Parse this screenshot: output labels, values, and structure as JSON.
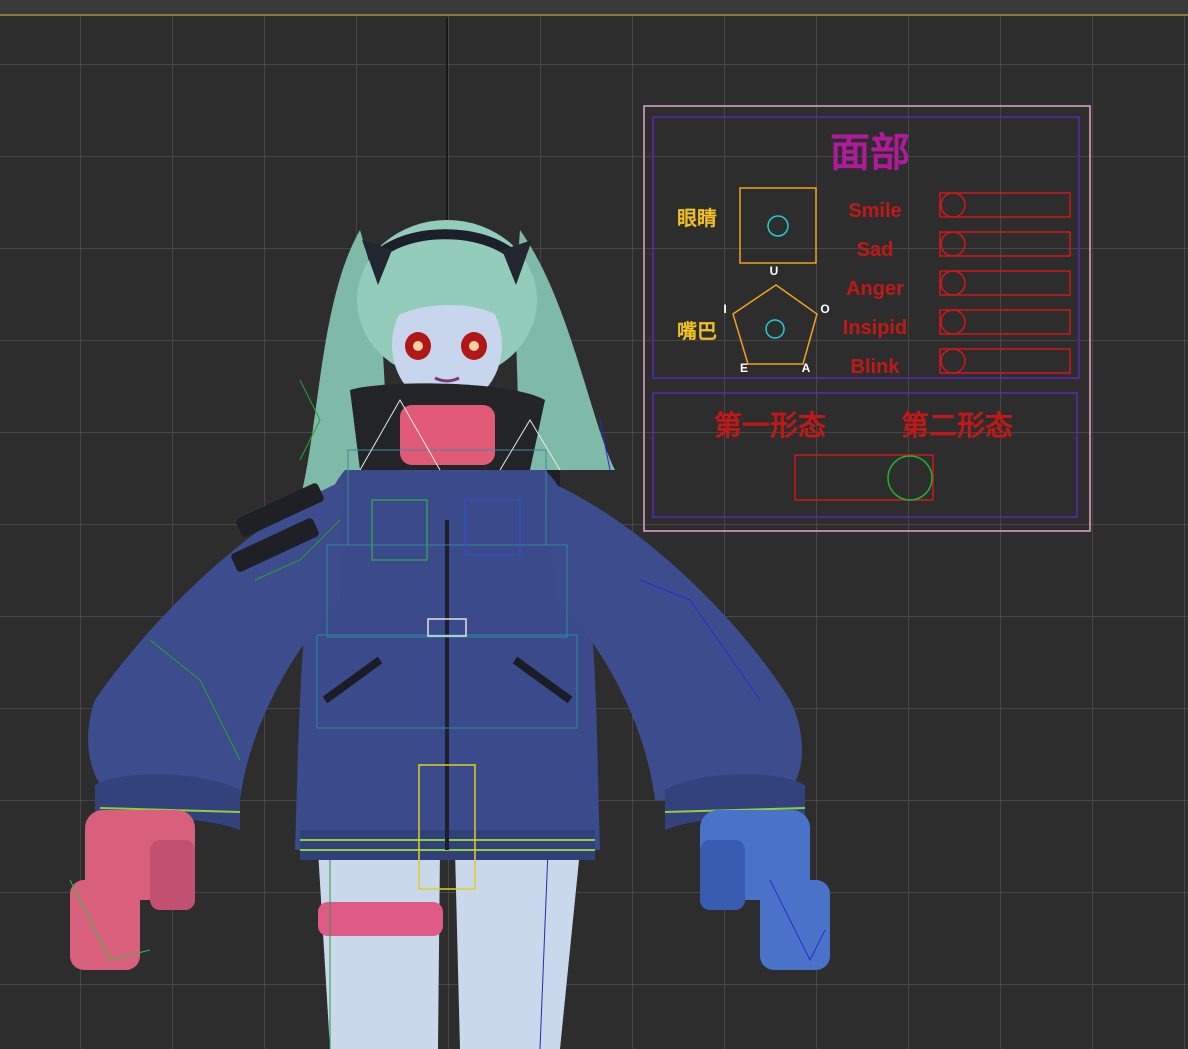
{
  "panel": {
    "title": "面部",
    "eyes_label": "眼睛",
    "mouth_label": "嘴巴",
    "vowels": {
      "u": "U",
      "i": "I",
      "o": "O",
      "e": "E",
      "a": "A"
    },
    "expressions": [
      {
        "label": "Smile",
        "value": 0
      },
      {
        "label": "Sad",
        "value": 0
      },
      {
        "label": "Anger",
        "value": 0
      },
      {
        "label": "Insipid",
        "value": 0
      },
      {
        "label": "Blink",
        "value": 0
      }
    ],
    "form_one": "第一形态",
    "form_two": "第二形态",
    "form_switch_value": 1
  },
  "colors": {
    "panel_outer": "#e0a0c0",
    "panel_inner": "#5a2ab0",
    "title": "#b01a9a",
    "label_yellow": "#f0c020",
    "control_orange": "#f0a020",
    "cyan": "#20d0d0",
    "red": "#d01818",
    "green": "#20b030",
    "jacket": "#3a4a8a",
    "hair": "#8ec8b8",
    "skin": "#c8d8ea",
    "left_hand": "#d85a7a",
    "right_hand": "#4a70c8"
  }
}
